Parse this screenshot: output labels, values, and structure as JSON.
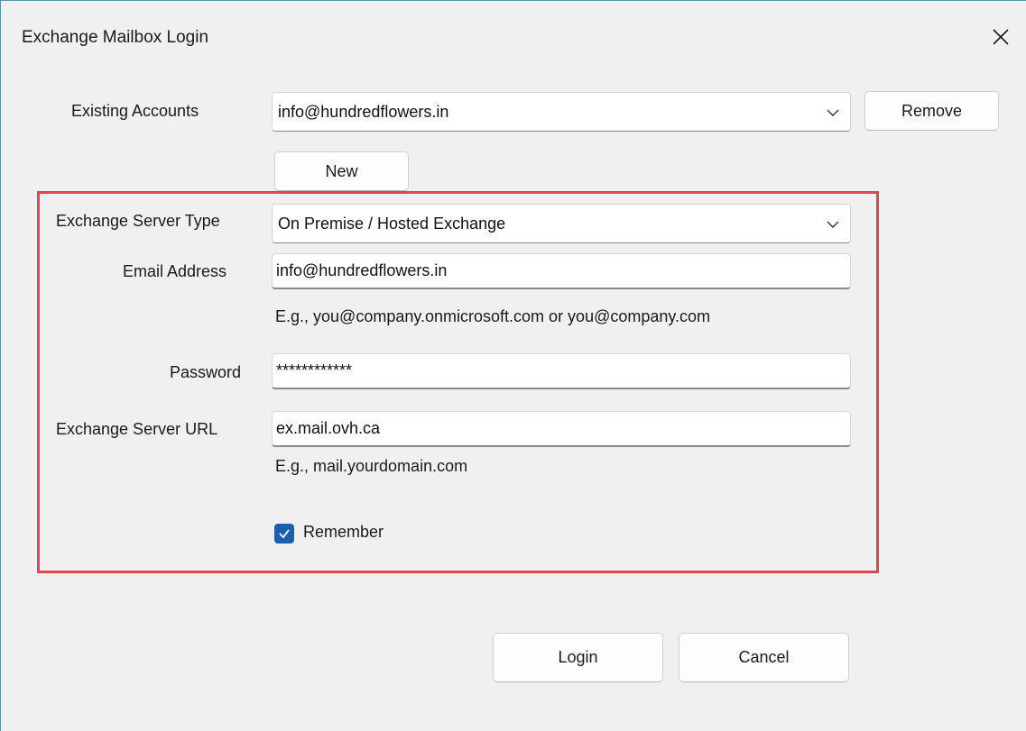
{
  "window": {
    "title": "Exchange Mailbox Login",
    "close_icon": "close-icon"
  },
  "accounts": {
    "label": "Existing Accounts",
    "selected": "info@hundredflowers.in",
    "remove_label": "Remove",
    "new_label": "New"
  },
  "form": {
    "server_type_label": "Exchange Server Type",
    "server_type_value": "On Premise / Hosted Exchange",
    "email_label": "Email Address",
    "email_value": "info@hundredflowers.in",
    "email_hint": "E.g., you@company.onmicrosoft.com or you@company.com",
    "password_label": "Password",
    "password_value": "************",
    "url_label": "Exchange Server URL",
    "url_value": "ex.mail.ovh.ca",
    "url_hint": "E.g., mail.yourdomain.com",
    "remember_label": "Remember",
    "remember_checked": true
  },
  "actions": {
    "login_label": "Login",
    "cancel_label": "Cancel"
  },
  "colors": {
    "highlight_border": "#e0474c",
    "checkbox_accent": "#1c5fb0",
    "window_background": "#f0f0f0"
  }
}
